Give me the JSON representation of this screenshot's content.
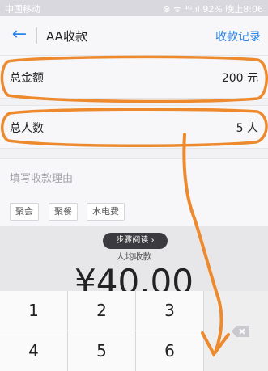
{
  "status_bar": {
    "carrier": "中国移动",
    "signal_text": "⊗ ᯤ ⁴ᴳ.ıl 92%",
    "time": "晚上8:06"
  },
  "header": {
    "back_icon": "back-arrow-icon",
    "title": "AA收款",
    "records_link": "收款记录"
  },
  "form": {
    "total_amount_label": "总金额",
    "total_amount_value": "200 元",
    "total_people_label": "总人数",
    "total_people_value": "5 人",
    "reason_placeholder": "填写收款理由",
    "tags": [
      "聚会",
      "聚餐",
      "水电费"
    ]
  },
  "tooltip": "步骤阅读 ›",
  "per_person": {
    "label": "人均收款",
    "amount": "¥40.00"
  },
  "keypad": {
    "keys": [
      "1",
      "2",
      "3",
      "4",
      "5",
      "6"
    ],
    "delete_icon": "backspace-icon"
  },
  "colors": {
    "accent": "#2a84e7",
    "annotation_orange": "#ee8a2e"
  }
}
